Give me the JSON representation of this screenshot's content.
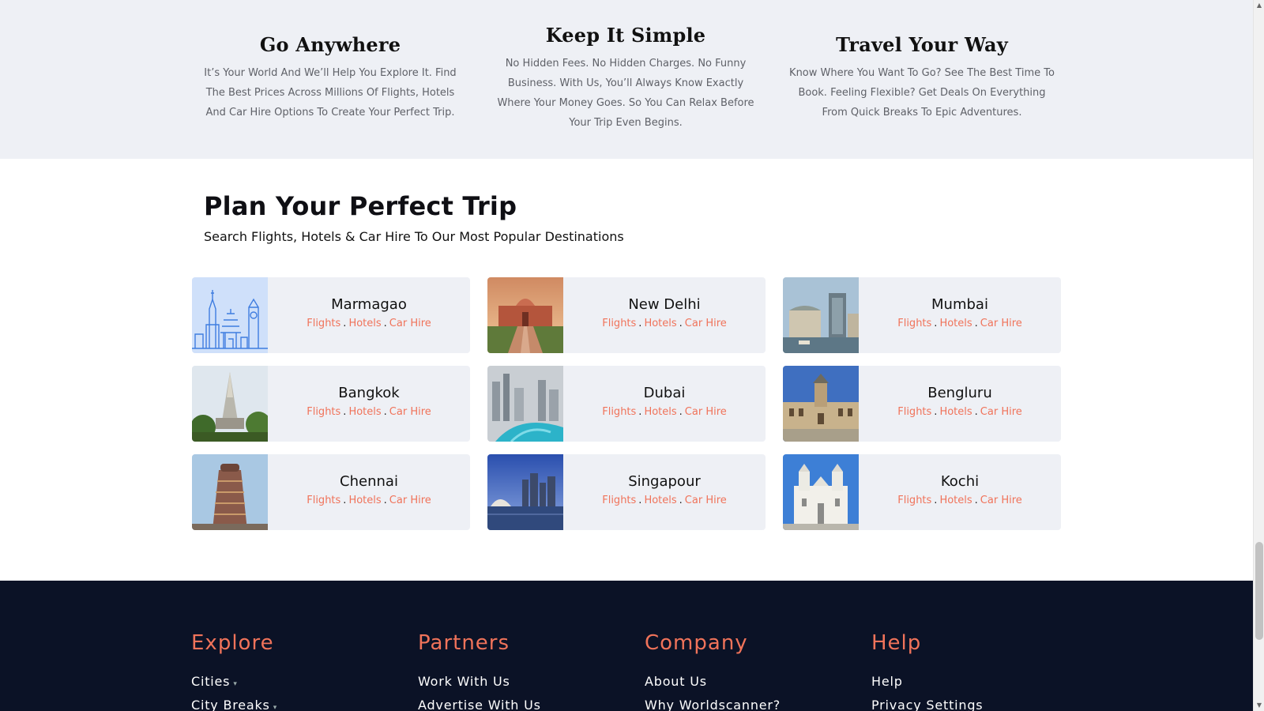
{
  "features": [
    {
      "title": "Go Anywhere",
      "text": "It’s Your World And We’ll Help You Explore It. Find The Best Prices Across Millions Of Flights, Hotels And Car Hire Options To Create Your Perfect Trip."
    },
    {
      "title": "Keep It Simple",
      "text": "No Hidden Fees. No Hidden Charges. No Funny Business. With Us, You’ll Always Know Exactly Where Your Money Goes. So You Can Relax Before Your Trip Even Begins."
    },
    {
      "title": "Travel Your Way",
      "text": "Know Where You Want To Go? See The Best Time To Book. Feeling Flexible? Get Deals On Everything From Quick Breaks To Epic Adventures."
    }
  ],
  "plan": {
    "title": "Plan Your Perfect Trip",
    "subtitle": "Search Flights, Hotels & Car Hire To Our Most Popular Destinations"
  },
  "link_labels": {
    "flights": "Flights",
    "hotels": "Hotels",
    "car_hire": "Car Hire",
    "separator": "."
  },
  "destinations": [
    {
      "city": "Marmagao"
    },
    {
      "city": "New Delhi"
    },
    {
      "city": "Mumbai"
    },
    {
      "city": "Bangkok"
    },
    {
      "city": "Dubai"
    },
    {
      "city": "Bengluru"
    },
    {
      "city": "Chennai"
    },
    {
      "city": "Singapour"
    },
    {
      "city": "Kochi"
    }
  ],
  "footer": {
    "explore": {
      "title": "Explore",
      "items": [
        "Cities",
        "City Breaks"
      ]
    },
    "partners": {
      "title": "Partners",
      "items": [
        "Work With Us",
        "Advertise With Us"
      ]
    },
    "company": {
      "title": "Company",
      "items": [
        "About Us",
        "Why Worldscanner?"
      ]
    },
    "help": {
      "title": "Help",
      "items": [
        "Help",
        "Privacy Settings"
      ]
    }
  },
  "colors": {
    "accent": "#f0735a",
    "footer_bg": "#0b1226",
    "card_bg": "#eef0f5",
    "band_bg": "#eef0f5"
  },
  "icons": {
    "scroll_up": "triangle-up-icon",
    "scroll_down": "triangle-down-icon",
    "submenu_caret": "caret-down-icon"
  }
}
